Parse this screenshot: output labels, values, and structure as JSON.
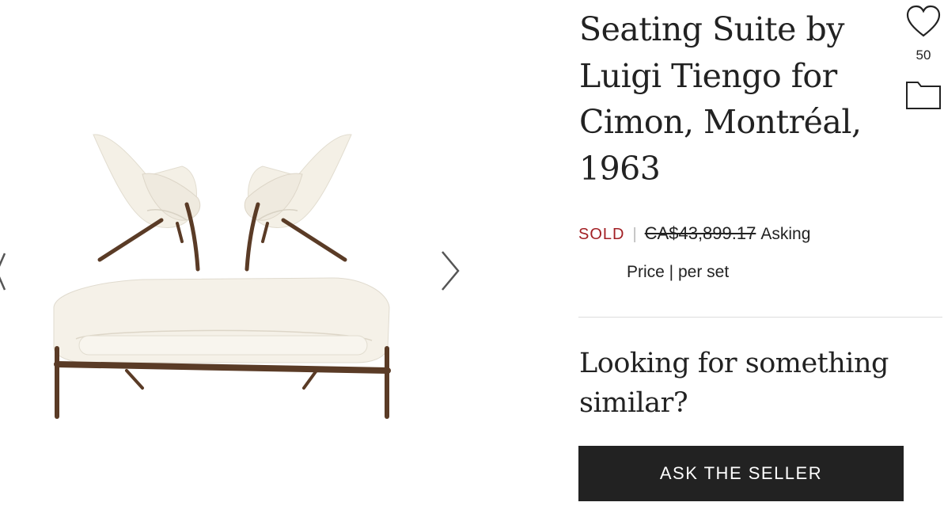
{
  "listing": {
    "title": "Seating Suite by Luigi Tiengo for Cimon, Montréal, 1963",
    "favorites_count": "50"
  },
  "price": {
    "status": "SOLD",
    "separator": "|",
    "amount": "CA$43,899.17",
    "label_asking": "Asking",
    "label_price": "Price | per set"
  },
  "cta": {
    "heading": "Looking for something similar?",
    "button_label": "ASK THE SELLER"
  },
  "icons": {
    "favorite": "heart-icon",
    "save": "folder-icon",
    "prev": "chevron-left-icon",
    "next": "chevron-right-icon"
  },
  "colors": {
    "sold": "#a21f24",
    "button_bg": "#222222",
    "button_text": "#ffffff"
  }
}
